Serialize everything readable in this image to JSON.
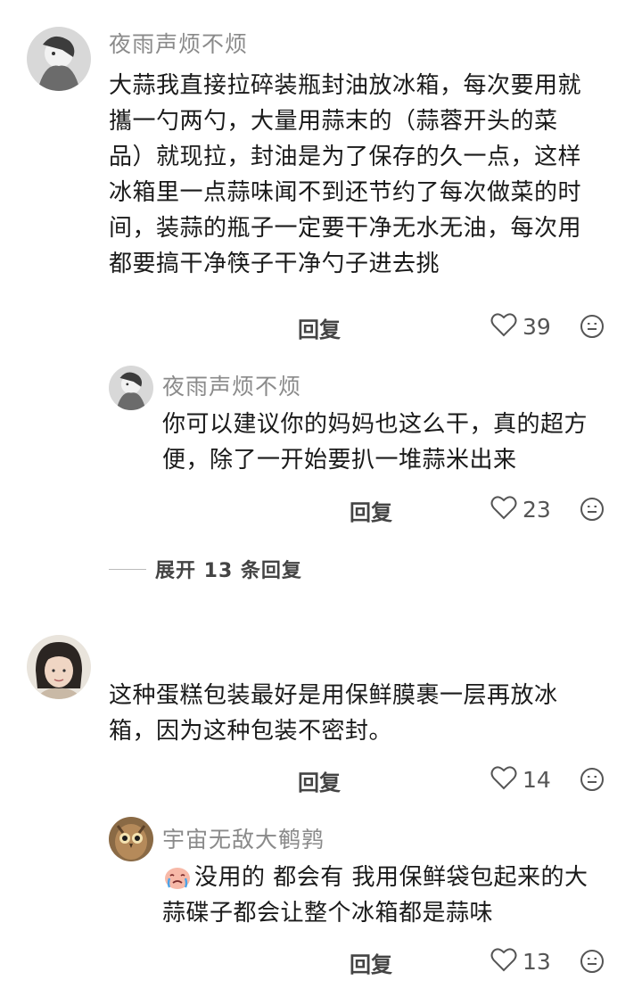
{
  "comments": [
    {
      "username": "夜雨声烦不烦",
      "lines": [
        "大蒜我直接拉碎装瓶封油放冰箱，每次要用就",
        "攜一勺两勺，大量用蒜末的（蒜蓉开头的菜",
        "品）就现拉，封油是为了保存的久一点，这样",
        "冰箱里一点蒜味闻不到还节约了每次做菜的时",
        "间，装蒜的瓶子一定要干净无水无油，每次用",
        "都要搞干净筷子干净勺子进去挑"
      ],
      "reply_label": "回复",
      "likes": "39",
      "replies": [
        {
          "username": "夜雨声烦不烦",
          "lines": [
            "你可以建议你的妈妈也这么干，真的超方",
            "便，除了一开始要扒一堆蒜米出来"
          ],
          "reply_label": "回复",
          "likes": "23"
        }
      ],
      "expand_label": "展开 13 条回复"
    },
    {
      "username": "",
      "lines": [
        "这种蛋糕包装最好是用保鲜膜裹一层再放冰",
        "箱，因为这种包装不密封。"
      ],
      "reply_label": "回复",
      "likes": "14",
      "replies": [
        {
          "username": "宇宙无敌大鹌鹑",
          "emoji_name": "crying-face-emoji",
          "lines": [
            "没用的 都会有 我用保鲜袋包起来的大",
            "蒜碟子都会让整个冰箱都是蒜味"
          ],
          "reply_label": "回复",
          "likes": "13"
        }
      ]
    }
  ],
  "colors": {
    "username": "#8a8a8a",
    "text": "#1a1a1a",
    "meta": "#555555"
  },
  "icons": {
    "like": "heart-outline-icon",
    "react": "smiley-icon"
  }
}
